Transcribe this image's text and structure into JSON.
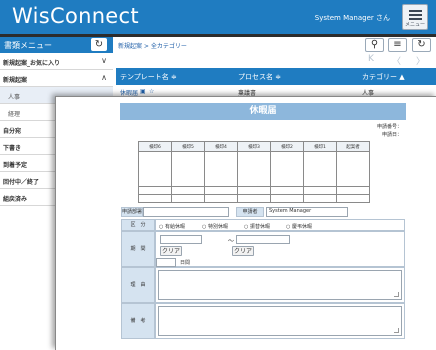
{
  "app": {
    "logo": "WisConnect",
    "user": "System Manager さん",
    "menu_label": "メニュー"
  },
  "sidebar": {
    "title": "書類メニュー",
    "refresh_icon": "refresh-icon",
    "items": [
      {
        "label": "新規起案_お気に入り",
        "chevron": "∨"
      },
      {
        "label": "新規起案",
        "chevron": "∧"
      },
      {
        "label": "人事"
      },
      {
        "label": "経理"
      },
      {
        "label": "自分宛"
      },
      {
        "label": "下書き"
      },
      {
        "label": "到着予定"
      },
      {
        "label": "回付中／終了"
      },
      {
        "label": "組戻済み"
      }
    ]
  },
  "main": {
    "breadcrumb": "新規起案 > 全カテゴリー",
    "columns": [
      "テンプレート名 ≑",
      "プロセス名 ≑",
      "カテゴリー ▲"
    ],
    "row": {
      "template": "休暇届",
      "process": "稟議書",
      "category": "人事"
    },
    "pager_prev": "〈",
    "pager_next": "〉",
    "pager_first": "K"
  },
  "doc": {
    "title": "休暇届",
    "apply_no_label": "申請番号：",
    "apply_date_label": "申請日：",
    "seal_headers": [
      "検印6",
      "検印5",
      "検印4",
      "検印3",
      "検印2",
      "検印1",
      "起案者"
    ],
    "dept_label": "申請部署",
    "applicant_label": "申請者",
    "applicant_value": "System Manager",
    "category_label": "区　分",
    "category_options": [
      "有給休暇",
      "特別休暇",
      "振替休暇",
      "慶弔休暇"
    ],
    "period_label": "期　間",
    "tilde": "〜",
    "clear_label_1": "クリア",
    "clear_label_2": "クリア",
    "days_unit": "日間",
    "reason_label": "理　由",
    "remarks_label": "備　考"
  }
}
